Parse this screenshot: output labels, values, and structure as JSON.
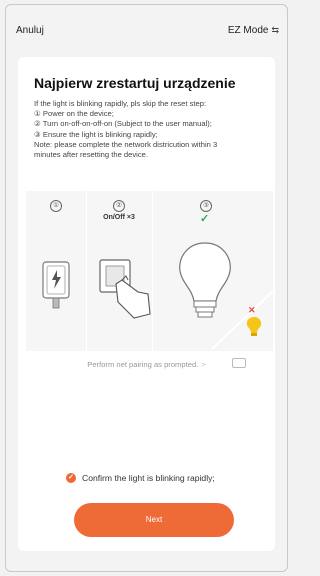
{
  "header": {
    "cancel_label": "Anuluj",
    "mode_label": "EZ Mode",
    "mode_icon": "swap-icon"
  },
  "main": {
    "title": "Najpierw zrestartuj urządzenie",
    "instructions": [
      "If the light is blinking rapidly, pls skip the reset step:",
      "① Power on the device;",
      "② Turn on-off-on-off-on (Subject to the user manual);",
      "③ Ensure the light is blinking rapidly;",
      "Note: please complete the network districution within 3",
      "minutes after resetting the device."
    ],
    "steps": [
      {
        "number": "①"
      },
      {
        "number": "②",
        "label": "On/Off ×3"
      },
      {
        "number": "③"
      }
    ],
    "pairing_text": "Perform net pairing as prompted.",
    "pairing_arrow": ">",
    "confirm_text": "Confirm the light is blinking rapidly;",
    "confirm_checked": true,
    "next_label": "Next"
  },
  "colors": {
    "accent": "#ee6a37",
    "check": "#27ae60",
    "error": "#e74c3c",
    "bulb": "#f5c518"
  }
}
